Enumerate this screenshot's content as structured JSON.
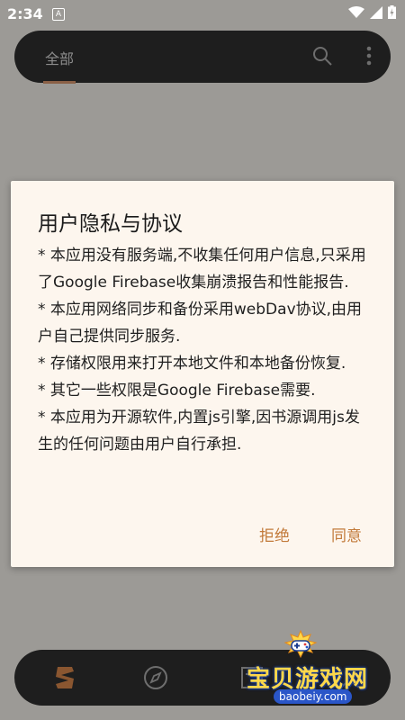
{
  "status_bar": {
    "time": "2:34",
    "notification_letter": "A"
  },
  "top_bar": {
    "tab_label": "全部"
  },
  "dialog": {
    "title": "用户隐私与协议",
    "body": [
      "* 本应用没有服务端,不收集任何用户信息,只采用了Google Firebase收集崩溃报告和性能报告.",
      "* 本应用网络同步和备份采用webDav协议,由用户自己提供同步服务.",
      "* 存储权限用来打开本地文件和本地备份恢复.",
      "* 其它一些权限是Google Firebase需要.",
      "* 本应用为开源软件,内置js引擎,因书源调用js发生的任何问题由用户自行承担."
    ],
    "reject_label": "拒绝",
    "accept_label": "同意"
  },
  "watermark": {
    "title": "宝贝游戏网",
    "url": "baobeiy.com"
  },
  "colors": {
    "accent": "#c27a3a",
    "dialog_bg": "#fdf6ee",
    "bar_bg": "#1e1e1e",
    "scrim": "#9c9a96"
  }
}
